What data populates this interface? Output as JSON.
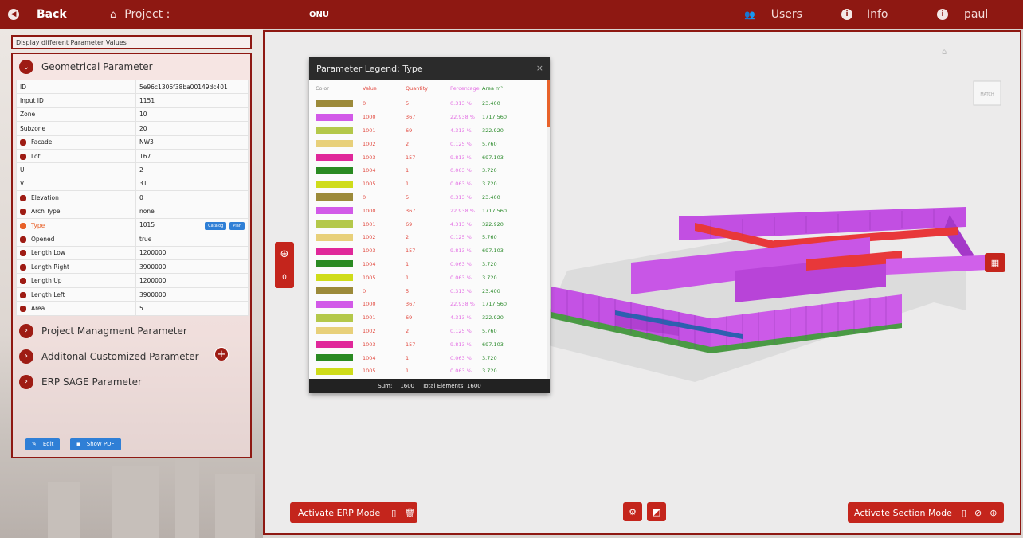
{
  "topbar": {
    "back_label": "Back",
    "project_label": "Project :",
    "project_name": "ONU",
    "users_label": "Users",
    "info_label": "Info",
    "user_name": "paul"
  },
  "left": {
    "display_title": "Display different Parameter Values",
    "geom_title": "Geometrical Parameter",
    "params": [
      {
        "key": "ID",
        "value": "5e96c1306f38ba00149dc401",
        "dot": false
      },
      {
        "key": "Input ID",
        "value": "1151",
        "dot": false
      },
      {
        "key": "Zone",
        "value": "10",
        "dot": false
      },
      {
        "key": "Subzone",
        "value": "20",
        "dot": false
      },
      {
        "key": "Facade",
        "value": "NW3",
        "dot": true
      },
      {
        "key": "Lot",
        "value": "167",
        "dot": true
      },
      {
        "key": "U",
        "value": "2",
        "dot": false
      },
      {
        "key": "V",
        "value": "31",
        "dot": false
      },
      {
        "key": "Elevation",
        "value": "0",
        "dot": true
      },
      {
        "key": "Arch Type",
        "value": "none",
        "dot": true
      },
      {
        "key": "Type",
        "value": "1015",
        "dot": true
      },
      {
        "key": "Opened",
        "value": "true",
        "dot": true
      },
      {
        "key": "Length Low",
        "value": "1200000",
        "dot": true
      },
      {
        "key": "Length Right",
        "value": "3900000",
        "dot": true
      },
      {
        "key": "Length Up",
        "value": "1200000",
        "dot": true
      },
      {
        "key": "Length Left",
        "value": "3900000",
        "dot": true
      },
      {
        "key": "Area",
        "value": "5",
        "dot": true
      }
    ],
    "catalog_label": "Catalog",
    "plan_label": "Plan",
    "pm_title": "Project Managment Parameter",
    "acp_title": "Additonal Customized Parameter",
    "erp_title": "ERP SAGE Parameter",
    "edit_label": "Edit",
    "pdf_label": "Show PDF"
  },
  "legend": {
    "title": "Parameter Legend: Type",
    "close": "×",
    "headers": {
      "color": "Color",
      "value": "Value",
      "quantity": "Quantity",
      "percentage": "Percentage",
      "area": "Area m²"
    },
    "rows": [
      {
        "color": "#9c8a3a",
        "value": "0",
        "quantity": "5",
        "percentage": "0.313 %",
        "area": "23.400"
      },
      {
        "color": "#d25ae8",
        "value": "1000",
        "quantity": "367",
        "percentage": "22.938 %",
        "area": "1717.560"
      },
      {
        "color": "#b4c84a",
        "value": "1001",
        "quantity": "69",
        "percentage": "4.313 %",
        "area": "322.920"
      },
      {
        "color": "#e8d07a",
        "value": "1002",
        "quantity": "2",
        "percentage": "0.125 %",
        "area": "5.760"
      },
      {
        "color": "#e0289a",
        "value": "1003",
        "quantity": "157",
        "percentage": "9.813 %",
        "area": "697.103"
      },
      {
        "color": "#2a8a22",
        "value": "1004",
        "quantity": "1",
        "percentage": "0.063 %",
        "area": "3.720"
      },
      {
        "color": "#cfdc1a",
        "value": "1005",
        "quantity": "1",
        "percentage": "0.063 %",
        "area": "3.720"
      },
      {
        "color": "#9c8a3a",
        "value": "0",
        "quantity": "5",
        "percentage": "0.313 %",
        "area": "23.400"
      },
      {
        "color": "#d25ae8",
        "value": "1000",
        "quantity": "367",
        "percentage": "22.938 %",
        "area": "1717.560"
      },
      {
        "color": "#b4c84a",
        "value": "1001",
        "quantity": "69",
        "percentage": "4.313 %",
        "area": "322.920"
      },
      {
        "color": "#e8d07a",
        "value": "1002",
        "quantity": "2",
        "percentage": "0.125 %",
        "area": "5.760"
      },
      {
        "color": "#e0289a",
        "value": "1003",
        "quantity": "157",
        "percentage": "9.813 %",
        "area": "697.103"
      },
      {
        "color": "#2a8a22",
        "value": "1004",
        "quantity": "1",
        "percentage": "0.063 %",
        "area": "3.720"
      },
      {
        "color": "#cfdc1a",
        "value": "1005",
        "quantity": "1",
        "percentage": "0.063 %",
        "area": "3.720"
      },
      {
        "color": "#9c8a3a",
        "value": "0",
        "quantity": "5",
        "percentage": "0.313 %",
        "area": "23.400"
      },
      {
        "color": "#d25ae8",
        "value": "1000",
        "quantity": "367",
        "percentage": "22.938 %",
        "area": "1717.560"
      },
      {
        "color": "#b4c84a",
        "value": "1001",
        "quantity": "69",
        "percentage": "4.313 %",
        "area": "322.920"
      },
      {
        "color": "#e8d07a",
        "value": "1002",
        "quantity": "2",
        "percentage": "0.125 %",
        "area": "5.760"
      },
      {
        "color": "#e0289a",
        "value": "1003",
        "quantity": "157",
        "percentage": "9.813 %",
        "area": "697.103"
      },
      {
        "color": "#2a8a22",
        "value": "1004",
        "quantity": "1",
        "percentage": "0.063 %",
        "area": "3.720"
      },
      {
        "color": "#cfdc1a",
        "value": "1005",
        "quantity": "1",
        "percentage": "0.063 %",
        "area": "3.720"
      }
    ],
    "sum_label": "Sum:",
    "sum_value": "1600",
    "total_label": "Total Elements: 1600"
  },
  "viewer": {
    "add_count": "0",
    "erp_label": "Activate ERP Mode",
    "section_label": "Activate Section Mode",
    "cube_label": "MATCH"
  },
  "colors": {
    "brand": "#8e1812",
    "button": "#c4251c",
    "accent": "#2f7fd6"
  }
}
